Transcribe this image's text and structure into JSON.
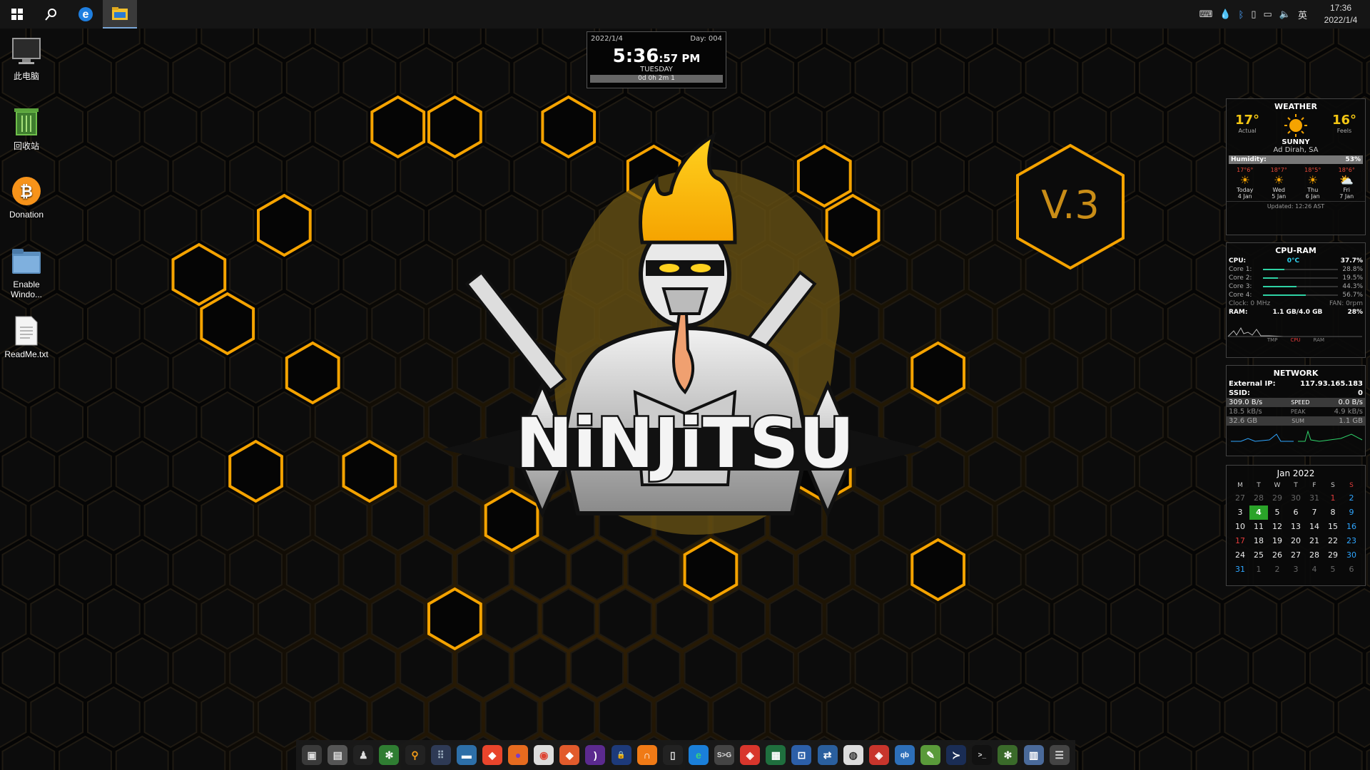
{
  "taskbar": {
    "items": [
      {
        "name": "windows-start-icon",
        "glyph": "⊞",
        "color": "#ffffff"
      },
      {
        "name": "search-icon",
        "glyph": "⚲",
        "color": "#ffffff"
      },
      {
        "name": "edge-icon",
        "glyph": "e",
        "color": "#1f7fe0"
      },
      {
        "name": "file-explorer-icon",
        "glyph": "▬",
        "color": "#f2c12e"
      }
    ],
    "tray": {
      "icons": [
        "keyboard-icon",
        "droplet-icon",
        "bluetooth-icon",
        "usb-icon",
        "network-icon",
        "volume-icon"
      ],
      "ime": "英",
      "time": "17:36",
      "date": "2022/1/4"
    }
  },
  "desktop_icons": [
    {
      "label": "此电脑",
      "icon": "monitor-icon"
    },
    {
      "label": "回收站",
      "icon": "recycle-bin-icon"
    },
    {
      "label": "Donation",
      "icon": "bitcoin-icon"
    },
    {
      "label": "Enable Windo...",
      "icon": "folder-icon"
    },
    {
      "label": "ReadMe.txt",
      "icon": "text-file-icon"
    }
  ],
  "clock_widget": {
    "date": "2022/1/4",
    "day_count": "Day: 004",
    "time_big": "5:36",
    "time_small": ":57 PM",
    "weekday": "TUESDAY",
    "uptime": "0d 0h 2m 1"
  },
  "wallpaper": {
    "title": "NiNJiTSU",
    "version": "V.3",
    "accent": "#f5a300"
  },
  "weather": {
    "title": "WEATHER",
    "actual_temp": "17°",
    "actual_label": "Actual",
    "feels_temp": "16°",
    "feels_label": "Feels",
    "condition": "SUNNY",
    "location": "Ad Dirah, SA",
    "humidity_label": "Humidity:",
    "humidity_value": "53%",
    "forecast": [
      {
        "hl": "17°6°",
        "day": "Today",
        "date": "4 Jan"
      },
      {
        "hl": "18°7°",
        "day": "Wed",
        "date": "5 Jan"
      },
      {
        "hl": "18°5°",
        "day": "Thu",
        "date": "6 Jan"
      },
      {
        "hl": "18°6°",
        "day": "Fri",
        "date": "7 Jan"
      }
    ],
    "updated": "Updated: 12:26 AST"
  },
  "cpu_ram": {
    "title": "CPU-RAM",
    "cpu_label": "CPU:",
    "temp": "0°C",
    "cpu_value": "37.7%",
    "cores": [
      {
        "label": "Core 1:",
        "value": "28.8%",
        "pct": 28.8
      },
      {
        "label": "Core 2:",
        "value": "19.5%",
        "pct": 19.5
      },
      {
        "label": "Core 3:",
        "value": "44.3%",
        "pct": 44.3
      },
      {
        "label": "Core 4:",
        "value": "56.7%",
        "pct": 56.7
      }
    ],
    "clock": "Clock: 0 MHz",
    "fan": "FAN: 0rpm",
    "ram_label": "RAM:",
    "ram_value": "1.1 GB/4.0 GB",
    "ram_pct": "28%",
    "legend": [
      "TMP",
      "CPU",
      "RAM"
    ]
  },
  "network": {
    "title": "NETWORK",
    "external_ip_label": "External IP:",
    "external_ip": "117.93.165.183",
    "ssid_label": "SSID:",
    "ssid": "0",
    "rows": [
      {
        "left": "309.0 B/s",
        "mid": "SPEED",
        "right": "0.0 B/s"
      },
      {
        "left": "18.5 kB/s",
        "mid": "PEAK",
        "right": "4.9 kB/s"
      },
      {
        "left": "32.6 GB",
        "mid": "SUM",
        "right": "1.1 GB"
      }
    ]
  },
  "calendar": {
    "title": "Jan 2022",
    "headers": [
      "M",
      "T",
      "W",
      "T",
      "F",
      "S",
      "S"
    ],
    "weeks": [
      [
        "27",
        "28",
        "29",
        "30",
        "31",
        "1",
        "2"
      ],
      [
        "3",
        "4",
        "5",
        "6",
        "7",
        "8",
        "9"
      ],
      [
        "10",
        "11",
        "12",
        "13",
        "14",
        "15",
        "16"
      ],
      [
        "17",
        "18",
        "19",
        "20",
        "21",
        "22",
        "23"
      ],
      [
        "24",
        "25",
        "26",
        "27",
        "28",
        "29",
        "30"
      ],
      [
        "31",
        "1",
        "2",
        "3",
        "4",
        "5",
        "6"
      ]
    ]
  },
  "dock": [
    {
      "name": "media-app-icon",
      "bg": "#3a3a3a",
      "glyph": "▣",
      "color": "#ddd"
    },
    {
      "name": "screenshot-app-icon",
      "bg": "#555",
      "glyph": "▤",
      "color": "#ddd"
    },
    {
      "name": "ninja-app-icon",
      "bg": "#222",
      "glyph": "♟",
      "color": "#ddd"
    },
    {
      "name": "settings-gear-icon",
      "bg": "#2f7d32",
      "glyph": "✻",
      "color": "#fff"
    },
    {
      "name": "search-app-icon",
      "bg": "#222",
      "glyph": "⚲",
      "color": "#f29b18"
    },
    {
      "name": "apps-grid-icon",
      "bg": "#2e3a55",
      "glyph": "⠿",
      "color": "#9ab"
    },
    {
      "name": "folder-app-icon",
      "bg": "#2d6fa8",
      "glyph": "▬",
      "color": "#fff"
    },
    {
      "name": "brave-browser-icon",
      "bg": "#e8452c",
      "glyph": "◆",
      "color": "#fff"
    },
    {
      "name": "firefox-icon",
      "bg": "#e66b1f",
      "glyph": "●",
      "color": "#7a3cc8"
    },
    {
      "name": "chrome-icon",
      "bg": "#ddd",
      "glyph": "◉",
      "color": "#d43"
    },
    {
      "name": "brave-beta-icon",
      "bg": "#e25b2c",
      "glyph": "◆",
      "color": "#fff"
    },
    {
      "name": "tor-browser-icon",
      "bg": "#5b2a8f",
      "glyph": ")",
      "color": "#fff"
    },
    {
      "name": "vpn-lock-icon",
      "bg": "#1d3a7a",
      "glyph": "🔒",
      "color": "#fff"
    },
    {
      "name": "headphones-icon",
      "bg": "#f07a16",
      "glyph": "∩",
      "color": "#fff"
    },
    {
      "name": "notes-icon",
      "bg": "#222",
      "glyph": "▯",
      "color": "#ddd"
    },
    {
      "name": "edge-browser-icon",
      "bg": "#1a7fd9",
      "glyph": "e",
      "color": "#3cd37a"
    },
    {
      "name": "sg-app-icon",
      "bg": "#444",
      "glyph": "S>G",
      "color": "#ddd"
    },
    {
      "name": "anydesk-icon",
      "bg": "#d8362c",
      "glyph": "◈",
      "color": "#fff"
    },
    {
      "name": "excel-sheet-icon",
      "bg": "#1f6f3e",
      "glyph": "▦",
      "color": "#fff"
    },
    {
      "name": "remote-desktop-icon",
      "bg": "#2c5fa8",
      "glyph": "⊡",
      "color": "#fff"
    },
    {
      "name": "network-tool-icon",
      "bg": "#2a5f9e",
      "glyph": "⇄",
      "color": "#fff"
    },
    {
      "name": "globe-icon",
      "bg": "#ddd",
      "glyph": "◍",
      "color": "#333"
    },
    {
      "name": "anydesk-red-icon",
      "bg": "#c8352c",
      "glyph": "◈",
      "color": "#fff"
    },
    {
      "name": "qbittorrent-icon",
      "bg": "#2d6fb8",
      "glyph": "qb",
      "color": "#fff"
    },
    {
      "name": "notepad-plus-icon",
      "bg": "#5a9a3a",
      "glyph": "✎",
      "color": "#fff"
    },
    {
      "name": "powershell-icon",
      "bg": "#1a2d55",
      "glyph": "≻",
      "color": "#fff"
    },
    {
      "name": "terminal-icon",
      "bg": "#111",
      "glyph": ">_",
      "color": "#ddd"
    },
    {
      "name": "gear-green-icon",
      "bg": "#3a6a2a",
      "glyph": "✻",
      "color": "#fff"
    },
    {
      "name": "control-panel-icon",
      "bg": "#4a6a9a",
      "glyph": "▥",
      "color": "#fff"
    },
    {
      "name": "sliders-icon",
      "bg": "#444",
      "glyph": "☰",
      "color": "#ddd"
    }
  ]
}
